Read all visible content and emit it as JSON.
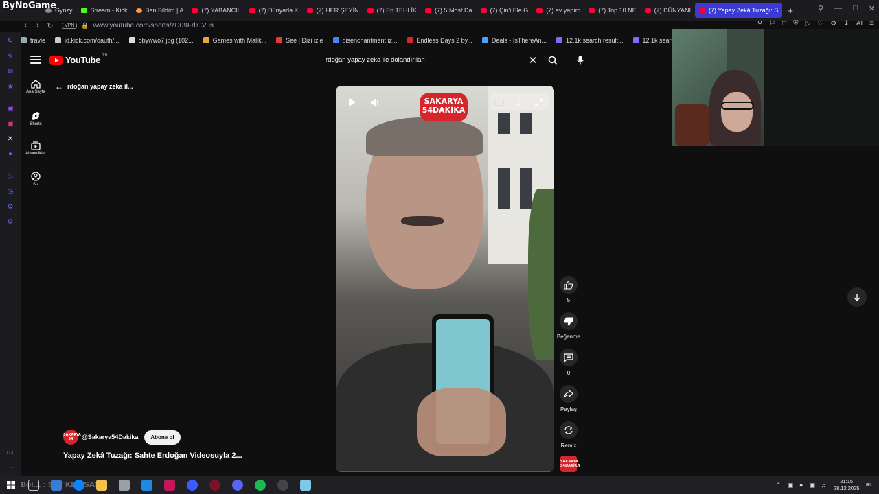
{
  "browser": {
    "brand": "ByNoGame",
    "tabs": [
      {
        "label": "Gynzy",
        "fav": "gray"
      },
      {
        "label": "Stream - Kick",
        "fav": "green"
      },
      {
        "label": "Ben Bildim | A",
        "fav": "orange"
      },
      {
        "label": "(7) YABANCIL",
        "fav": "yt"
      },
      {
        "label": "(7) Dünyada K",
        "fav": "yt"
      },
      {
        "label": "(7) HER ŞEYİN",
        "fav": "yt"
      },
      {
        "label": "(7) En TEHLİK",
        "fav": "yt"
      },
      {
        "label": "(7) 5 Most Da",
        "fav": "yt"
      },
      {
        "label": "(7) Çin'i Ele G",
        "fav": "yt"
      },
      {
        "label": "(7) ev yapım",
        "fav": "yt"
      },
      {
        "label": "(7) Top 10 NE",
        "fav": "yt"
      },
      {
        "label": "(7) DÜNYANI",
        "fav": "yt"
      },
      {
        "label": "(7) Yapay Zekâ Tuzağı: S",
        "fav": "yt",
        "active": true
      }
    ],
    "new_tab": "+",
    "vpn": "VPN",
    "url": "www.youtube.com/shorts/zD09FdlCVus",
    "ai_label": "AI",
    "bookmarks": [
      "travle",
      "id.kick.com/oauth/...",
      "obywwo7.jpg (102...",
      "Games with Malik...",
      "See | Dizi izle",
      "disenchantment iz...",
      "Endless Days 2 by...",
      "Deals - IsThereAn...",
      "12.1k search result...",
      "12.1k search result..."
    ]
  },
  "youtube": {
    "logo_text": "YouTube",
    "logo_region": "TR",
    "search_query": "rdoğan yapay zeka ile dolandırılan",
    "nav": [
      {
        "label": "Ana Sayfa",
        "icon": "home-icon"
      },
      {
        "label": "Shorts",
        "icon": "shorts-icon"
      },
      {
        "label": "Abonelikler",
        "icon": "subscriptions-icon"
      },
      {
        "label": "Siz",
        "icon": "you-icon"
      }
    ],
    "back_text": "rdoğan yapay zeka il...",
    "video_brand": "SAKARYA 54DAKİKA",
    "actions": {
      "like_count": "5",
      "dislike_label": "Beğenme",
      "comment_count": "0",
      "share_label": "Paylaş",
      "remix_label": "Remix"
    },
    "channel_name": "@Sakarya54Dakika",
    "subscribe_label": "Abone ol",
    "video_title": "Yapay Zekâ Tuzağı: Sahte Erdoğan Videosuyla 2..."
  },
  "taskbar": {
    "ghost_text": "Bol... : SAT KDS SAT",
    "time": "21:15",
    "date": "28.12.2025"
  },
  "colors": {
    "yt_red": "#ff0000",
    "brand_red": "#d6262d",
    "active_tab": "#3b3bd4",
    "background": "#0f0f0f"
  }
}
